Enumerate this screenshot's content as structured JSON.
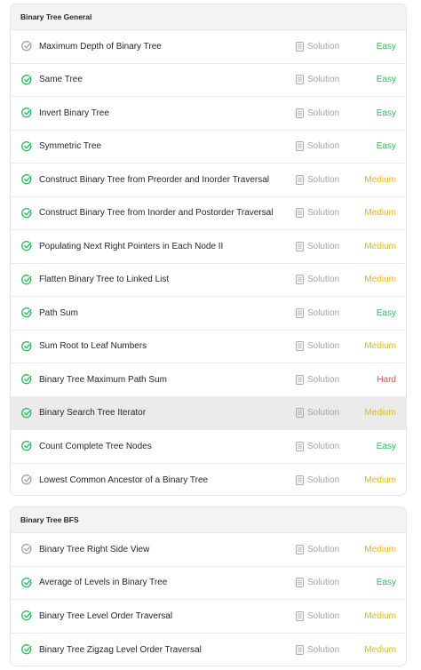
{
  "colors": {
    "easy": "#2cbb5d",
    "medium": "#e7b60b",
    "hard": "#d9534f",
    "solved_check": "#2cbb5d",
    "attempted_check": "#a3a3a3"
  },
  "sections": [
    {
      "title": "Binary Tree General",
      "problems": [
        {
          "title": "Maximum Depth of Binary Tree",
          "solution": "Solution",
          "difficulty": "Easy",
          "level": "easy",
          "status": "attempted"
        },
        {
          "title": "Same Tree",
          "solution": "Solution",
          "difficulty": "Easy",
          "level": "easy",
          "status": "solved"
        },
        {
          "title": "Invert Binary Tree",
          "solution": "Solution",
          "difficulty": "Easy",
          "level": "easy",
          "status": "solved"
        },
        {
          "title": "Symmetric Tree",
          "solution": "Solution",
          "difficulty": "Easy",
          "level": "easy",
          "status": "solved"
        },
        {
          "title": "Construct Binary Tree from Preorder and Inorder Traversal",
          "solution": "Solution",
          "difficulty": "Medium",
          "level": "medium",
          "status": "solved"
        },
        {
          "title": "Construct Binary Tree from Inorder and Postorder Traversal",
          "solution": "Solution",
          "difficulty": "Medium",
          "level": "medium",
          "status": "solved"
        },
        {
          "title": "Populating Next Right Pointers in Each Node II",
          "solution": "Solution",
          "difficulty": "Medium",
          "level": "medium",
          "status": "solved"
        },
        {
          "title": "Flatten Binary Tree to Linked List",
          "solution": "Solution",
          "difficulty": "Medium",
          "level": "medium",
          "status": "solved"
        },
        {
          "title": "Path Sum",
          "solution": "Solution",
          "difficulty": "Easy",
          "level": "easy",
          "status": "solved"
        },
        {
          "title": "Sum Root to Leaf Numbers",
          "solution": "Solution",
          "difficulty": "Medium",
          "level": "medium",
          "status": "solved"
        },
        {
          "title": "Binary Tree Maximum Path Sum",
          "solution": "Solution",
          "difficulty": "Hard",
          "level": "hard",
          "status": "solved"
        },
        {
          "title": "Binary Search Tree Iterator",
          "solution": "Solution",
          "difficulty": "Medium",
          "level": "medium",
          "status": "solved",
          "highlight": true
        },
        {
          "title": "Count Complete Tree Nodes",
          "solution": "Solution",
          "difficulty": "Easy",
          "level": "easy",
          "status": "solved"
        },
        {
          "title": "Lowest Common Ancestor of a Binary Tree",
          "solution": "Solution",
          "difficulty": "Medium",
          "level": "medium",
          "status": "attempted"
        }
      ]
    },
    {
      "title": "Binary Tree BFS",
      "problems": [
        {
          "title": "Binary Tree Right Side View",
          "solution": "Solution",
          "difficulty": "Medium",
          "level": "medium",
          "status": "attempted"
        },
        {
          "title": "Average of Levels in Binary Tree",
          "solution": "Solution",
          "difficulty": "Easy",
          "level": "easy",
          "status": "solved"
        },
        {
          "title": "Binary Tree Level Order Traversal",
          "solution": "Solution",
          "difficulty": "Medium",
          "level": "medium",
          "status": "solved"
        },
        {
          "title": "Binary Tree Zigzag Level Order Traversal",
          "solution": "Solution",
          "difficulty": "Medium",
          "level": "medium",
          "status": "solved"
        }
      ]
    }
  ]
}
